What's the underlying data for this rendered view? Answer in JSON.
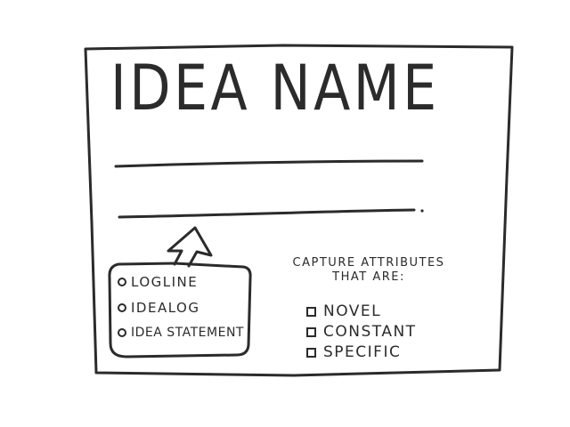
{
  "card": {
    "title": "IDEA NAME",
    "ink_color": "#2b2b2b"
  },
  "formats": {
    "items": [
      {
        "label": "LOGLINE",
        "icon": "bullet-circle-icon"
      },
      {
        "label": "IDEALOG",
        "icon": "bullet-circle-icon"
      },
      {
        "label": "IDEA STATEMENT",
        "icon": "bullet-circle-icon"
      }
    ]
  },
  "attributes": {
    "heading_line1": "CAPTURE ATTRIBUTES",
    "heading_line2": "THAT ARE:",
    "items": [
      {
        "label": "NOVEL",
        "icon": "checkbox-icon"
      },
      {
        "label": "CONSTANT",
        "icon": "checkbox-icon"
      },
      {
        "label": "SPECIFIC",
        "icon": "checkbox-icon"
      }
    ]
  }
}
